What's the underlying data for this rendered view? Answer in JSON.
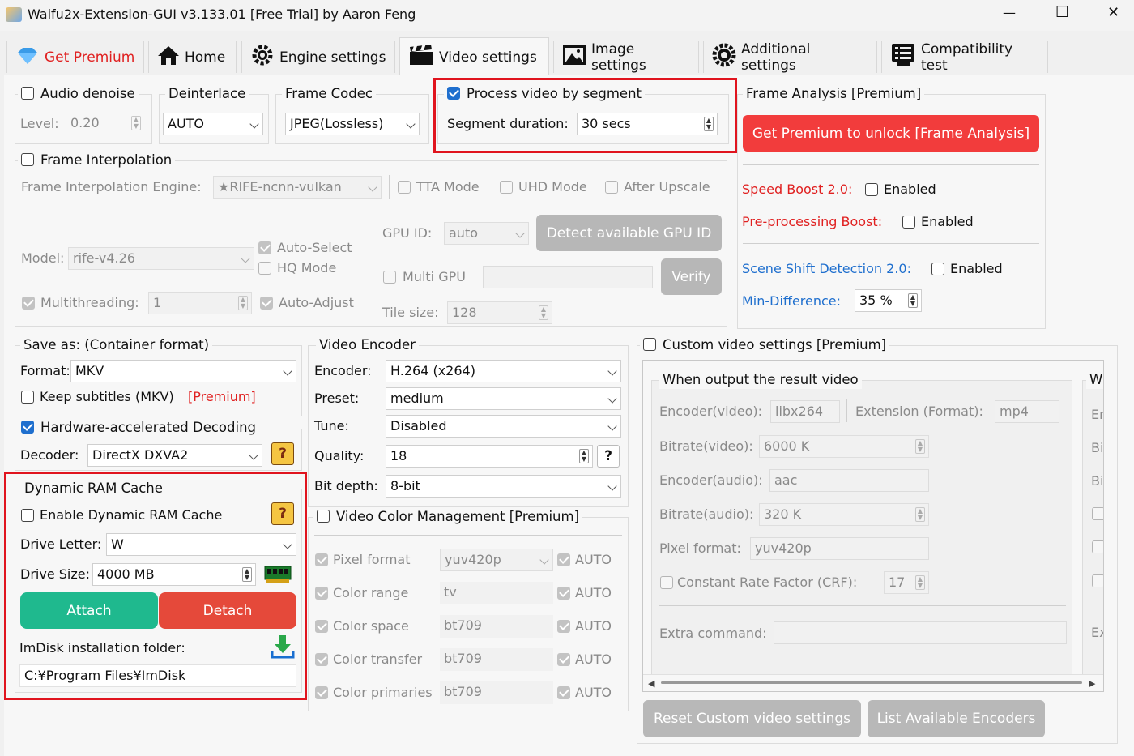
{
  "window": {
    "title": "Waifu2x-Extension-GUI v3.133.01 [Free Trial] by Aaron Feng",
    "minimize": "—",
    "maximize": "☐",
    "close": "✕"
  },
  "tabs": [
    {
      "label": "Get Premium",
      "icon": "diamond-icon"
    },
    {
      "label": "Home",
      "icon": "home-icon"
    },
    {
      "label": "Engine settings",
      "icon": "engine-gear-icon"
    },
    {
      "label": "Video settings",
      "icon": "film-clapper-icon"
    },
    {
      "label": "Image settings",
      "icon": "image-icon"
    },
    {
      "label": "Additional settings",
      "icon": "gear-icon"
    },
    {
      "label": "Compatibility test",
      "icon": "checklist-icon"
    }
  ],
  "audio": {
    "title": "Audio denoise",
    "level_label": "Level:",
    "level_value": "0.20"
  },
  "deinterlace": {
    "title": "Deinterlace",
    "value": "AUTO"
  },
  "frame_codec": {
    "title": "Frame Codec",
    "value": "JPEG(Lossless)"
  },
  "segment": {
    "title": "Process video by segment",
    "duration_label": "Segment duration:",
    "duration_value": "30 secs"
  },
  "frame_interp": {
    "title": "Frame Interpolation",
    "engine_label": "Frame Interpolation Engine:",
    "engine_value": "★RIFE-ncnn-vulkan",
    "tta": "TTA Mode",
    "uhd": "UHD Mode",
    "after_upscale": "After Upscale",
    "model_label": "Model:",
    "model_value": "rife-v4.26",
    "auto_select": "Auto-Select",
    "hq_mode": "HQ Mode",
    "multithreading_label": "Multithreading:",
    "multithreading_value": "1",
    "auto_adjust": "Auto-Adjust",
    "gpu_id_label": "GPU ID:",
    "gpu_id_value": "auto",
    "detect_gpu": "Detect available GPU ID",
    "multi_gpu": "Multi GPU",
    "verify": "Verify",
    "tile_label": "Tile size:",
    "tile_value": "128"
  },
  "frame_analysis": {
    "title": "Frame Analysis [Premium]",
    "unlock": "Get Premium to unlock [Frame Analysis]",
    "speed_boost": "Speed Boost 2.0:",
    "pre_boost": "Pre-processing Boost:",
    "enabled": "Enabled",
    "scene_shift": "Scene Shift Detection 2.0:",
    "min_diff_label": "Min-Difference:",
    "min_diff_value": "35 %"
  },
  "save_as": {
    "title": "Save as: (Container format)",
    "format_label": "Format:",
    "format_value": "MKV",
    "keep_subs": "Keep subtitles (MKV)",
    "premium": "[Premium]"
  },
  "hw_decode": {
    "title": "Hardware-accelerated Decoding",
    "decoder_label": "Decoder:",
    "decoder_value": "DirectX DXVA2",
    "help": "?"
  },
  "ram_cache": {
    "title": "Dynamic RAM Cache",
    "enable": "Enable Dynamic RAM Cache",
    "help": "?",
    "drive_letter_label": "Drive Letter:",
    "drive_letter_value": "W",
    "drive_size_label": "Drive Size:",
    "drive_size_value": "4000 MB",
    "attach": "Attach",
    "detach": "Detach",
    "imdisk_label": "ImDisk installation folder:",
    "imdisk_path": "C:¥Program Files¥ImDisk"
  },
  "video_encoder": {
    "title": "Video Encoder",
    "encoder_label": "Encoder:",
    "encoder_value": "H.264 (x264)",
    "preset_label": "Preset:",
    "preset_value": "medium",
    "tune_label": "Tune:",
    "tune_value": "Disabled",
    "quality_label": "Quality:",
    "quality_value": "18",
    "help": "?",
    "bitdepth_label": "Bit depth:",
    "bitdepth_value": "8-bit"
  },
  "color_mgmt": {
    "title": "Video Color Management [Premium]",
    "auto": "AUTO",
    "rows": [
      {
        "label": "Pixel format",
        "value": "yuv420p"
      },
      {
        "label": "Color range",
        "value": "tv"
      },
      {
        "label": "Color space",
        "value": "bt709"
      },
      {
        "label": "Color transfer",
        "value": "bt709"
      },
      {
        "label": "Color primaries",
        "value": "bt709"
      }
    ]
  },
  "custom": {
    "title": "Custom video settings [Premium]",
    "inner_title": "When output the result video",
    "clipped_title": "W",
    "enc_video_label": "Encoder(video):",
    "enc_video_value": "libx264",
    "ext_label": "Extension (Format):",
    "ext_value": "mp4",
    "br_video_label": "Bitrate(video):",
    "br_video_value": "6000 K",
    "enc_audio_label": "Encoder(audio):",
    "enc_audio_value": "aac",
    "br_audio_label": "Bitrate(audio):",
    "br_audio_value": "320 K",
    "pix_label": "Pixel format:",
    "pix_value": "yuv420p",
    "crf_label": "Constant Rate Factor (CRF):",
    "crf_value": "17",
    "extra_label": "Extra command:",
    "clipped_labels": [
      "Er",
      "Bi",
      "Bi",
      "Ex"
    ],
    "reset": "Reset Custom video settings",
    "list": "List Available Encoders"
  },
  "colors": {
    "accent": "#1f6fce",
    "red": "#f23c3c",
    "green": "#1fb98e",
    "detach": "#e5493a",
    "highlight": "#e0141e",
    "blue_text": "#1f6fce",
    "red_text": "#e02020"
  }
}
